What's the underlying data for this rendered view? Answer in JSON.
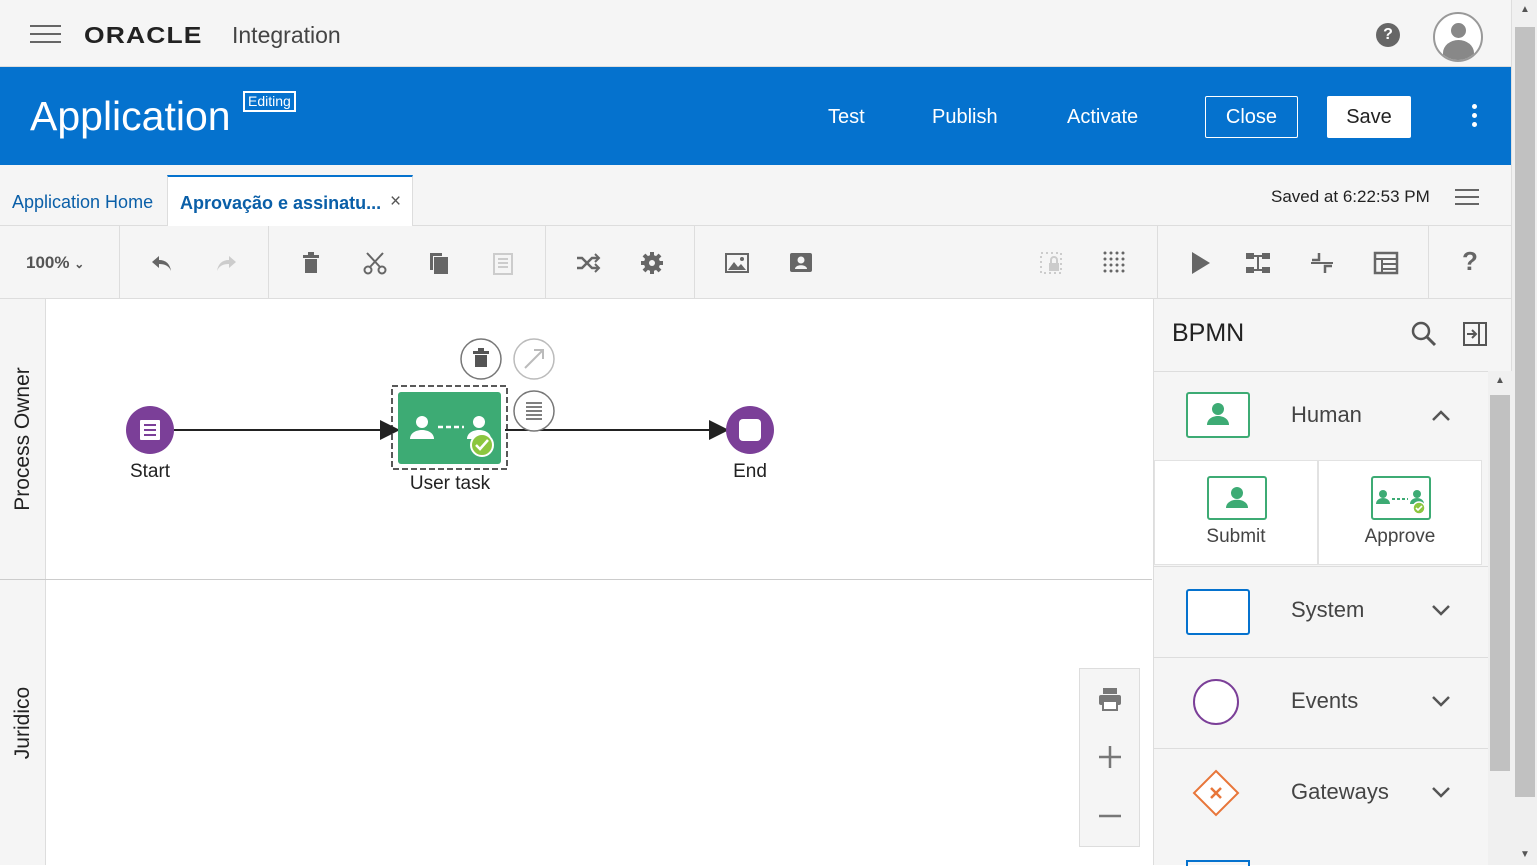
{
  "topbar": {
    "logo": "ORACLE",
    "product": "Integration",
    "help": "?"
  },
  "banner": {
    "title": "Application",
    "status_badge": "Editing",
    "actions": {
      "test": "Test",
      "publish": "Publish",
      "activate": "Activate",
      "close": "Close",
      "save": "Save"
    }
  },
  "tabs": {
    "home": "Application Home",
    "active": "Aprovação e assinatu...",
    "close_symbol": "×",
    "saved_at": "Saved at 6:22:53 PM"
  },
  "toolbar": {
    "zoom": "100%"
  },
  "lanes": [
    "Process Owner",
    "Juridico"
  ],
  "diagram": {
    "nodes": {
      "start": "Start",
      "user_task": "User task",
      "end": "End"
    }
  },
  "palette": {
    "title": "BPMN",
    "categories": {
      "human": "Human",
      "system": "System",
      "events": "Events",
      "gateways": "Gateways"
    },
    "human_items": {
      "submit": "Submit",
      "approve": "Approve"
    }
  },
  "colors": {
    "brand_blue": "#0572ce",
    "task_green": "#3dab74",
    "event_purple": "#7b3f98",
    "gateway_orange": "#e8763a"
  }
}
